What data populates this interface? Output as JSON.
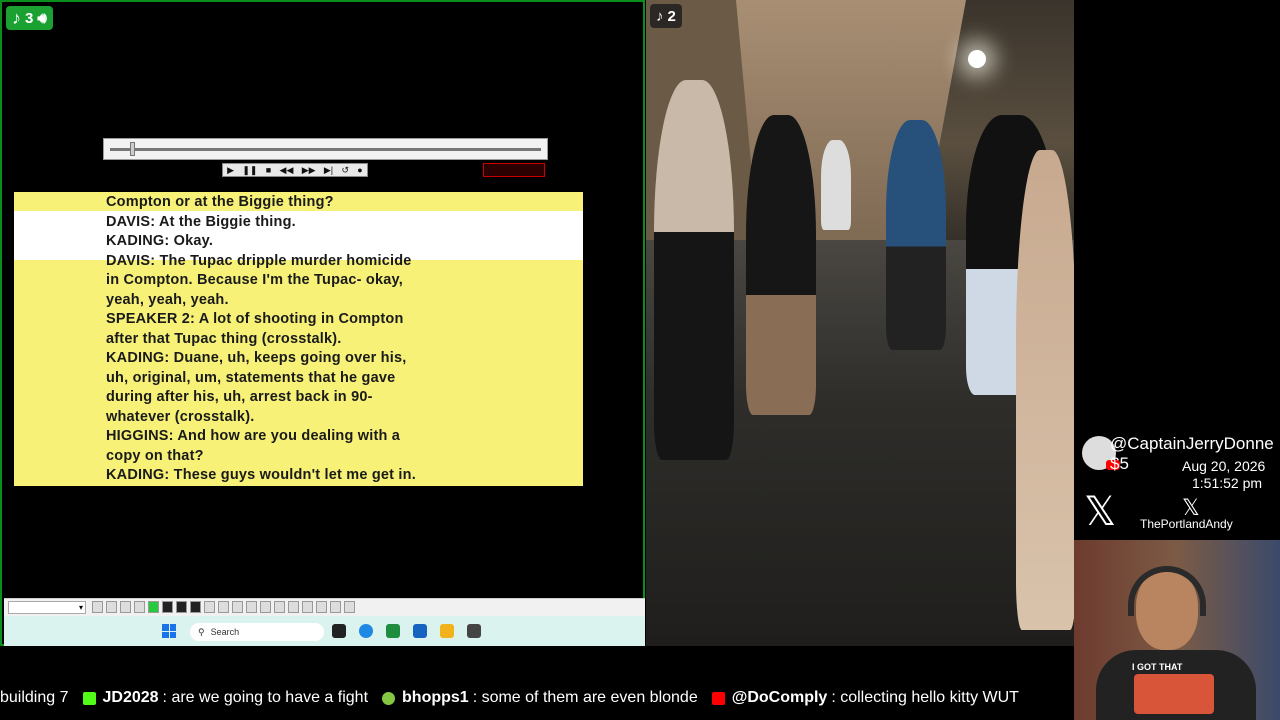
{
  "left_panel": {
    "badge_count": "3",
    "transcript_lines": [
      "Compton or at the Biggie thing?",
      "DAVIS: At the Biggie thing.",
      "KADING: Okay.",
      "DAVIS: The Tupac dripple murder homicide",
      "in Compton. Because I'm the Tupac- okay,",
      "yeah, yeah, yeah.",
      "SPEAKER 2: A lot of shooting in Compton",
      "after that Tupac thing (crosstalk).",
      "KADING: Duane, uh, keeps going over his,",
      "uh, original, um, statements that he gave",
      "during after his, uh, arrest back in 90-",
      "whatever (crosstalk).",
      "HIGGINS: And how are you dealing with a",
      "copy on that?",
      "KADING: These guys wouldn't let me get in."
    ],
    "taskbar": {
      "search_placeholder": "Search"
    }
  },
  "video": {
    "badge_count": "2"
  },
  "overlay": {
    "donor": "@CaptainJerryDonne",
    "donation_amount": "$5",
    "date": "Aug 20, 2026",
    "time": "1:51:52 pm",
    "x_handle": "ThePortlandAndy"
  },
  "webcam": {
    "shirt_text": "I GOT THAT"
  },
  "ticker": [
    {
      "user": "",
      "text": "building 7",
      "platform": "none"
    },
    {
      "user": "JD2028",
      "text": ": are we going to have a fight",
      "platform": "kick"
    },
    {
      "user": "bhopps1",
      "text": ": some of them are even blonde",
      "platform": "rumble"
    },
    {
      "user": "@DoComply",
      "text": ": collecting hello kitty WUT",
      "platform": "youtube"
    }
  ],
  "colors": {
    "accent_green": "#1aa132",
    "transcript_yellow": "#f7f277",
    "taskbar_teal": "#dbf3ef"
  }
}
